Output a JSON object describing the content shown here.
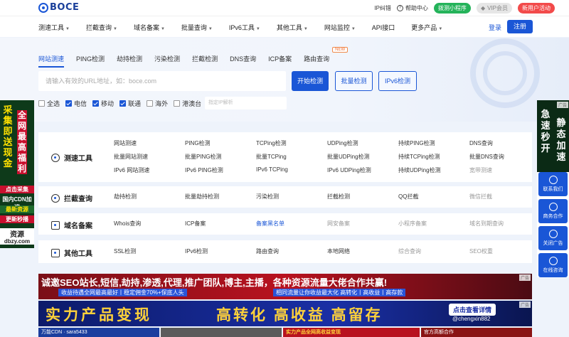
{
  "brand": {
    "name": "BOCE"
  },
  "top_links": {
    "ip_correct": "IP纠错",
    "help": "帮助中心",
    "mini_program": "拨测小程序",
    "vip": "VIP会员",
    "new_user": "新用户活动"
  },
  "nav": {
    "items": [
      {
        "label": "测速工具",
        "caret": "▼"
      },
      {
        "label": "拦截查询",
        "caret": "▼"
      },
      {
        "label": "域名备案",
        "caret": "▼"
      },
      {
        "label": "批量查询",
        "caret": "▼"
      },
      {
        "label": "IPv6工具",
        "caret": "▼"
      },
      {
        "label": "其他工具",
        "caret": "▼"
      },
      {
        "label": "网站监控",
        "caret": "▼"
      },
      {
        "label": "API接口",
        "caret": ""
      },
      {
        "label": "更多产品",
        "caret": "▼"
      }
    ],
    "login": "登录",
    "register": "注册"
  },
  "hero": {
    "tabs": [
      "网站测速",
      "PING检测",
      "劫持检测",
      "污染检测",
      "拦截检测",
      "DNS查询",
      "ICP备案",
      "路由查询"
    ],
    "new_badge": "NEW",
    "search_placeholder": "请输入有效的URL地址，如：boce.com",
    "start_button": "开始检测",
    "batch_button": "批量检测",
    "ipv6_button": "IPv6检测",
    "filters": [
      {
        "label": "全选",
        "checked": false
      },
      {
        "label": "电信",
        "checked": true
      },
      {
        "label": "移动",
        "checked": true
      },
      {
        "label": "联通",
        "checked": true
      },
      {
        "label": "海外",
        "checked": false
      },
      {
        "label": "港澳台",
        "checked": false
      }
    ],
    "ip_placeholder": "指定IP解析"
  },
  "tools": {
    "speed": {
      "title": "测速工具",
      "rows": [
        [
          "网站测速",
          "PING检测",
          "TCPing检测",
          "UDPing检测",
          "持续PING检测",
          "DNS查询"
        ],
        [
          "批量网站测速",
          "批量PING检测",
          "批量TCPing",
          "批量UDPing检测",
          "持续TCPing检测",
          "批量DNS查询"
        ],
        [
          "IPv6 网站测速",
          "IPv6 PING检测",
          "IPv6 TCPing",
          "IPv6 UDPing检测",
          "持续UDPing检测",
          "宽带测速"
        ]
      ]
    },
    "block": {
      "title": "拦截查询",
      "items": [
        "劫持检测",
        "批量劫持检测",
        "污染检测",
        "拦截检测",
        "QQ拦截",
        "微信拦截"
      ]
    },
    "record": {
      "title": "域名备案",
      "items": [
        "Whois查询",
        "ICP备案",
        "备案黑名单",
        "网安备案",
        "小程序备案",
        "域名到期查询"
      ]
    },
    "other": {
      "title": "其他工具",
      "items": [
        "SSL检测",
        "IPv6检测",
        "路由查询",
        "本地网络",
        "综合查询",
        "SEO权重"
      ]
    }
  },
  "side_left": {
    "col1": "采集即送现金",
    "col2": "全网最高福利",
    "strip1": "点击采集",
    "strip2": "国内CDN加速",
    "strip3": "最新资源",
    "strip4": "更新秒播",
    "strip5": "资源",
    "domain": "dbzy.com"
  },
  "side_right": {
    "col1": "急速秒开",
    "col2": "静态加速",
    "ad": "广告"
  },
  "float_bar": {
    "items": [
      "联系我们",
      "商务合作",
      "关闭广告",
      "在线咨询"
    ]
  },
  "ads": {
    "tag": "广告",
    "banner1_title": "诚邀SEO站长,短信,劫持,渗透,代理,推广团队,博主,主播，各种资源流量大佬合作共赢!",
    "banner1_sub1": "收益待遇全网最高最好丨稳定佣金70%+保底人头",
    "banner1_sub2": "相同流量让你收益最大化 高转化丨高收益丨高存款",
    "banner2_left": "实力产品变现",
    "banner2_right": "高转化  高收益  高留存",
    "banner2_cta": "点击查看详情",
    "banner2_id": "@chengxin882",
    "banner3": [
      "万能CDN",
      "sara5433",
      "实力产品全网高收益变现",
      "官方高额合作"
    ]
  }
}
